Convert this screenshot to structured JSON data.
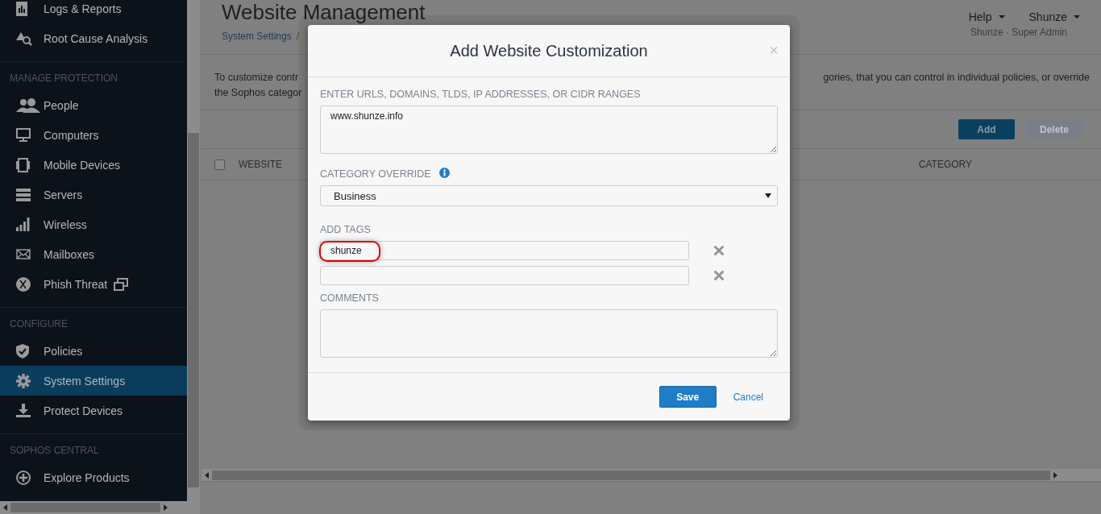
{
  "sidebar": {
    "sections": [
      {
        "items": [
          {
            "label": "Logs & Reports",
            "selected": false
          },
          {
            "label": "Root Cause Analysis",
            "selected": false
          }
        ]
      },
      {
        "heading": "MANAGE PROTECTION",
        "items": [
          {
            "label": "People",
            "selected": false
          },
          {
            "label": "Computers",
            "selected": false
          },
          {
            "label": "Mobile Devices",
            "selected": false
          },
          {
            "label": "Servers",
            "selected": false
          },
          {
            "label": "Wireless",
            "selected": false
          },
          {
            "label": "Mailboxes",
            "selected": false
          },
          {
            "label": "Phish Threat",
            "selected": false,
            "external": true
          }
        ]
      },
      {
        "heading": "CONFIGURE",
        "items": [
          {
            "label": "Policies",
            "selected": false
          },
          {
            "label": "System Settings",
            "selected": true
          },
          {
            "label": "Protect Devices",
            "selected": false
          }
        ]
      },
      {
        "heading": "SOPHOS CENTRAL",
        "items": [
          {
            "label": "Explore Products",
            "selected": false
          }
        ]
      }
    ]
  },
  "page": {
    "title": "Website Management",
    "breadcrumb": [
      "System Settings",
      "/"
    ],
    "menus": [
      "Help",
      "Shunze"
    ],
    "role": "Shunze · Super Admin",
    "description_left": [
      "To customize contr",
      "the Sophos categor"
    ],
    "description_right": "gories, that you can control in individual policies, or override",
    "toolbar": [
      {
        "label": "Add",
        "disabled": false
      },
      {
        "label": "Delete",
        "disabled": true
      }
    ],
    "table": {
      "select_all_checked": false,
      "columns": [
        "WEBSITE",
        "CATEGORY"
      ]
    }
  },
  "dialog": {
    "title": "Add Website Customization",
    "close": "×",
    "urls_label": "ENTER URLS, DOMAINS, TLDS, IP ADDRESSES, OR CIDR RANGES",
    "urls_value": "www.shunze.info",
    "category_label": "CATEGORY OVERRIDE",
    "category_value": "Business",
    "tags_label": "ADD TAGS",
    "tags": [
      {
        "value": "shunze",
        "highlighted": true
      },
      {
        "highlighted": false
      }
    ],
    "comments_label": "COMMENTS",
    "buttons": [
      {
        "label": "Save",
        "kind": "primary"
      },
      {
        "label": "Cancel",
        "kind": "link"
      }
    ]
  }
}
